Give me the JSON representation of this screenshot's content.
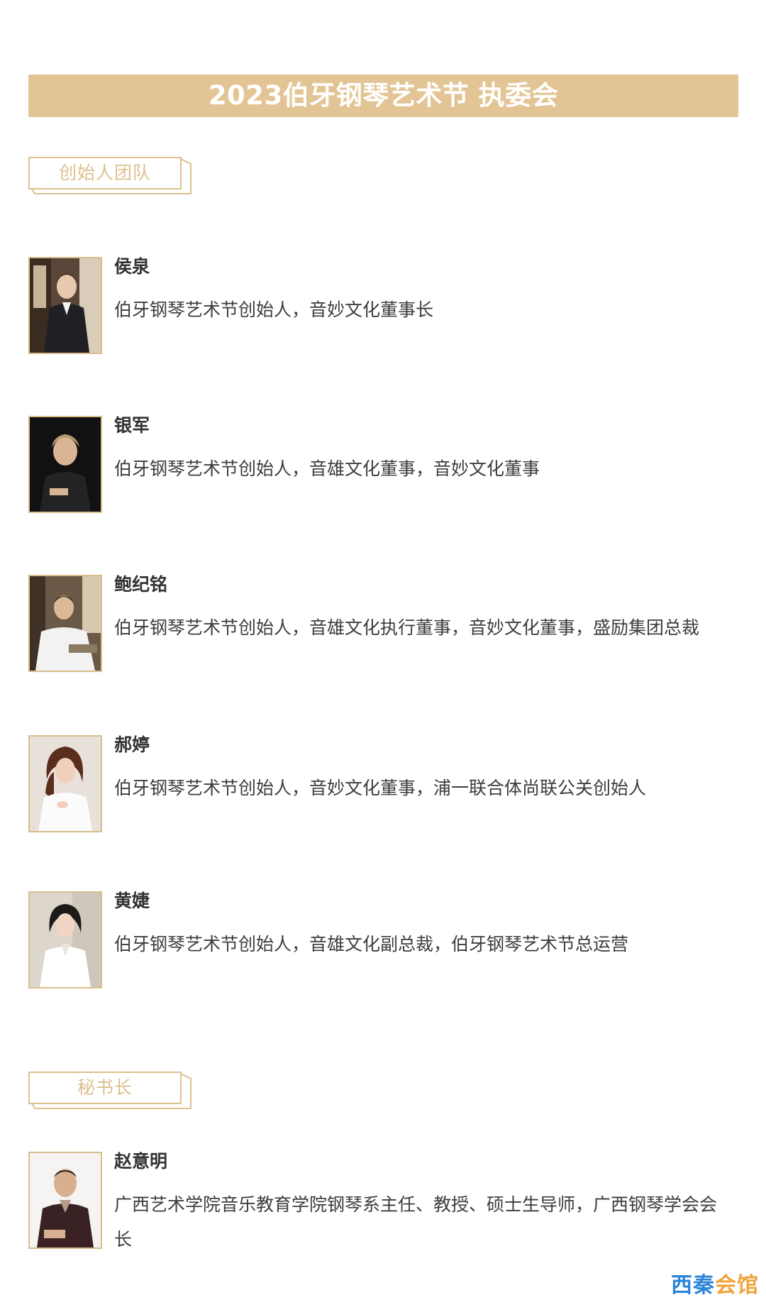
{
  "banner": {
    "title": "2023伯牙钢琴艺术节 执委会"
  },
  "sections": {
    "founders": {
      "label": "创始人团队"
    },
    "secretary": {
      "label": "秘书长"
    }
  },
  "founders": [
    {
      "name": "侯泉",
      "description": "伯牙钢琴艺术节创始人，音妙文化董事长"
    },
    {
      "name": "银军",
      "description": "伯牙钢琴艺术节创始人，音雄文化董事，音妙文化董事"
    },
    {
      "name": "鲍纪铭",
      "description": "伯牙钢琴艺术节创始人，音雄文化执行董事，音妙文化董事，盛励集团总裁"
    },
    {
      "name": "郝婷",
      "description": "伯牙钢琴艺术节创始人，音妙文化董事，浦一联合体尚联公关创始人"
    },
    {
      "name": "黄婕",
      "description": "伯牙钢琴艺术节创始人，音雄文化副总裁，伯牙钢琴艺术节总运营"
    }
  ],
  "secretary": [
    {
      "name": "赵意明",
      "description": "广西艺术学院音乐教育学院钢琴系主任、教授、硕士生导师，广西钢琴学会会长"
    }
  ],
  "watermark": {
    "part1": "西秦",
    "part2": "会馆"
  },
  "colors": {
    "banner_bg": "#e3c595",
    "accent_gold": "#d9bd8e",
    "text_dark": "#333333",
    "watermark_blue": "#2c84d8",
    "watermark_orange": "#f0a53b"
  }
}
